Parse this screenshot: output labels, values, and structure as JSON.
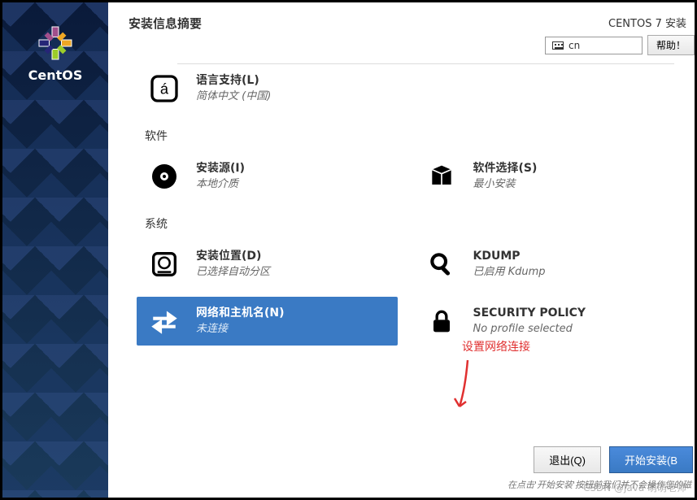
{
  "sidebar": {
    "brand": "CentOS"
  },
  "header": {
    "title": "安装信息摘要",
    "install_distro": "CENTOS 7 安装",
    "lang_code": "cn",
    "help_label": "帮助！"
  },
  "sections": {
    "localization": {
      "lang_support": {
        "title": "语言支持(L)",
        "sub": "简体中文 (中国)"
      }
    },
    "software": {
      "heading": "软件",
      "install_source": {
        "title": "安装源(I)",
        "sub": "本地介质"
      },
      "software_select": {
        "title": "软件选择(S)",
        "sub": "最小安装"
      }
    },
    "system": {
      "heading": "系统",
      "install_dest": {
        "title": "安装位置(D)",
        "sub": "已选择自动分区"
      },
      "kdump": {
        "title": "KDUMP",
        "sub": "已启用 Kdump"
      },
      "network": {
        "title": "网络和主机名(N)",
        "sub": "未连接"
      },
      "security": {
        "title": "SECURITY POLICY",
        "sub": "No profile selected"
      }
    }
  },
  "footer": {
    "quit_label": "退出(Q)",
    "begin_label": "开始安装(B",
    "hint": "在点击'开始安装'按钮前我们并不会操作您的磁"
  },
  "annotation": {
    "text": "设置网络连接"
  },
  "watermark": "CSDN @java 萌萌老师"
}
